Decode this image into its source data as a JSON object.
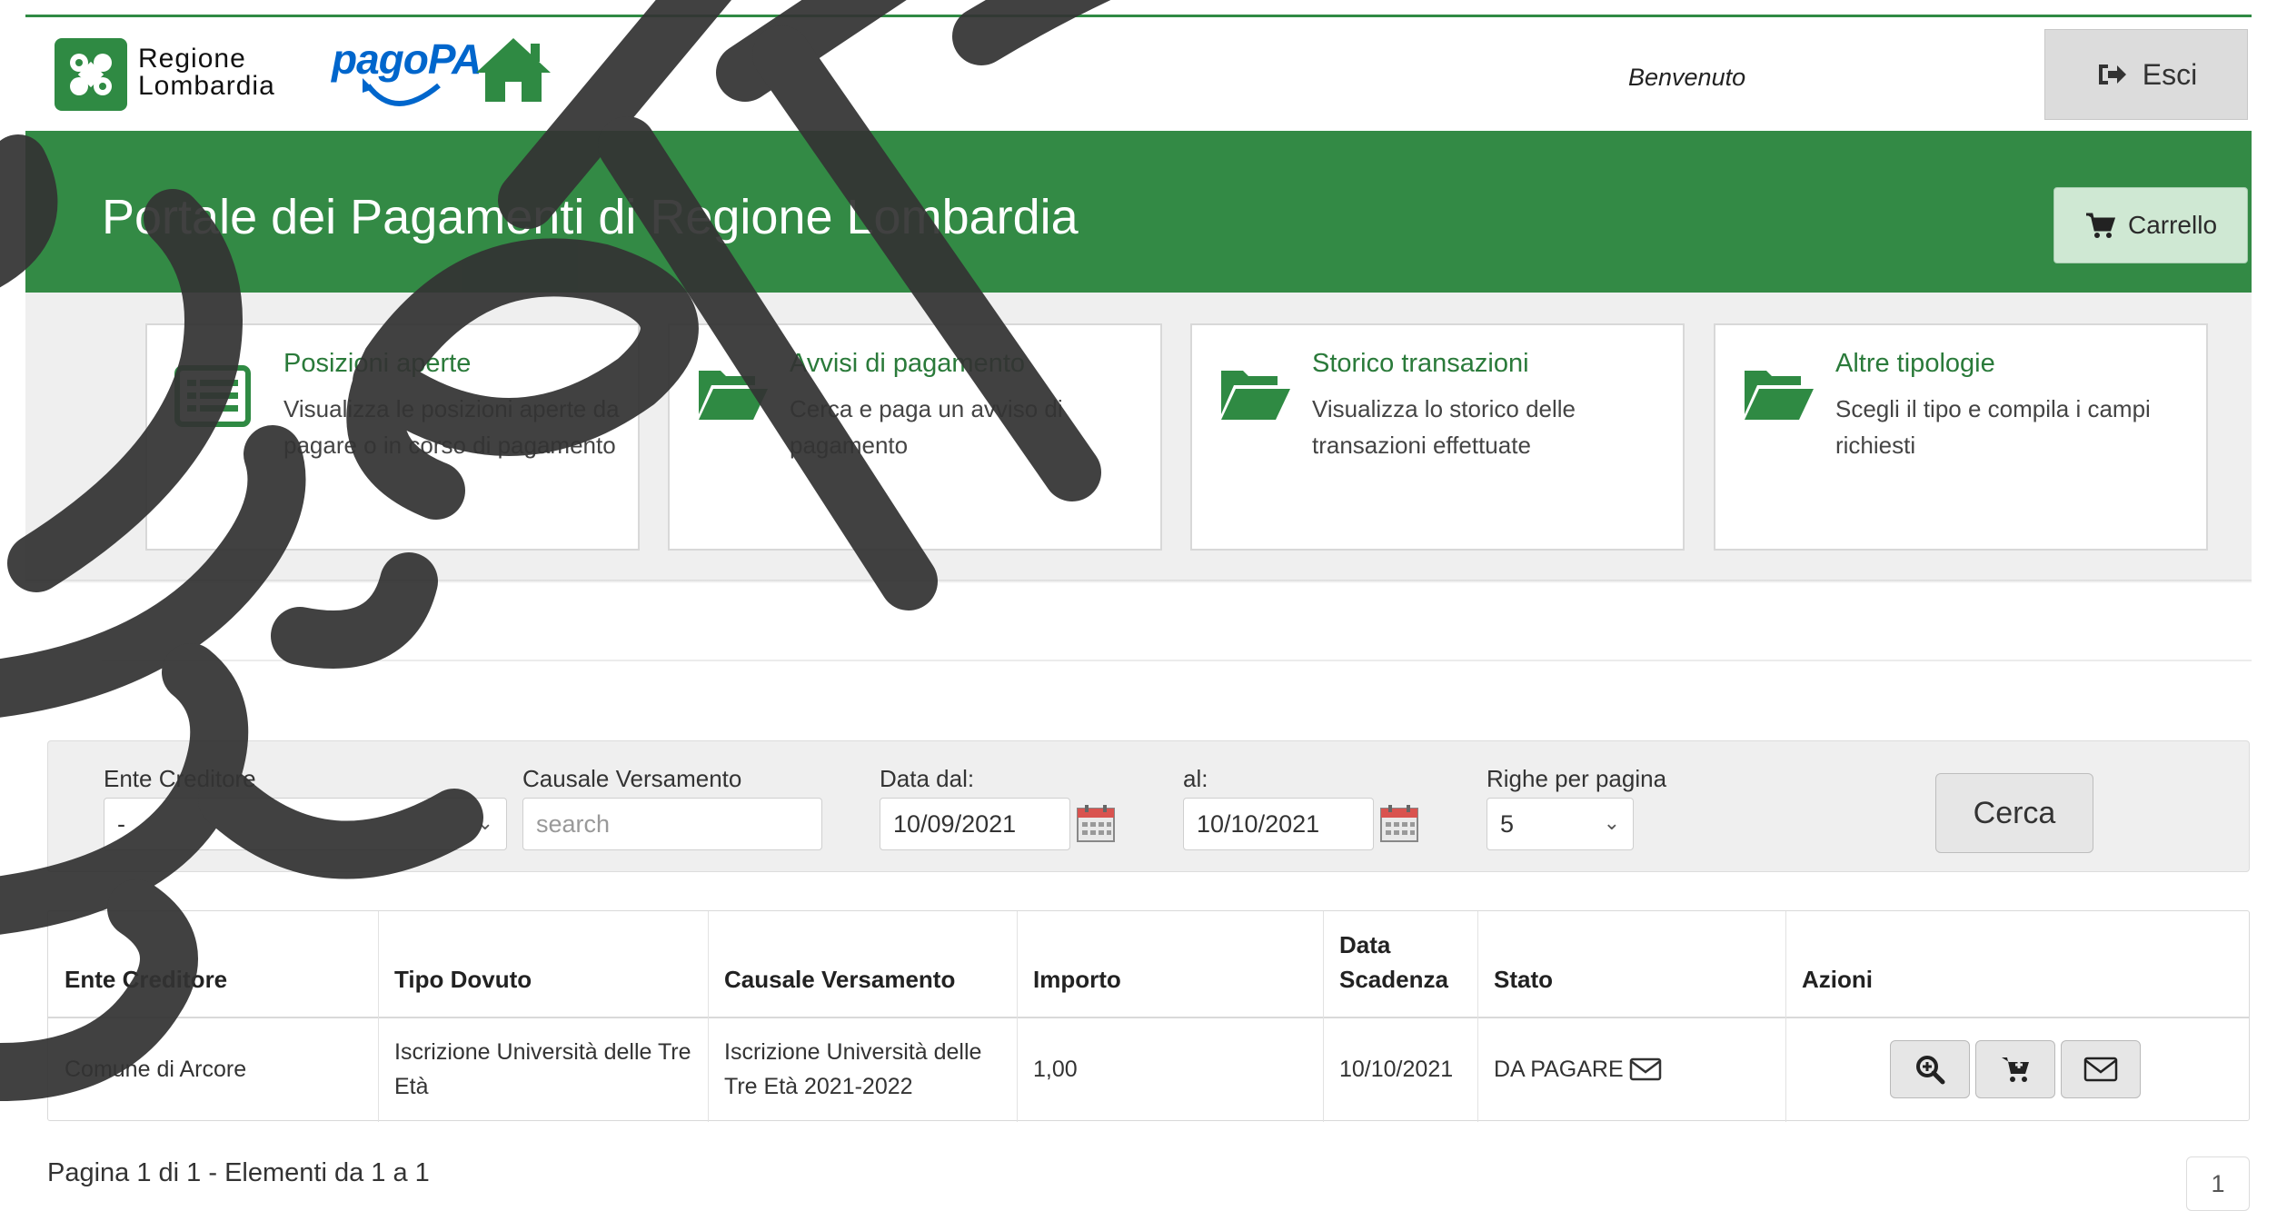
{
  "header": {
    "logo_line1": "Regione",
    "logo_line2": "Lombardia",
    "pagopa_logo": "pagoPA",
    "home_icon": "home-icon",
    "welcome": "Benvenuto",
    "logout_label": "Esci"
  },
  "banner": {
    "title": "Portale dei Pagamenti di Regione Lombardia",
    "cart_label": "Carrello"
  },
  "cards": [
    {
      "title": "Posizioni aperte",
      "desc": "Visualizza le posizioni aperte da pagare o in corso di pagamento",
      "icon": "list-icon"
    },
    {
      "title": "Avvisi di pagamento",
      "desc": "Cerca e paga un avviso di pagamento",
      "icon": "folder-open-icon"
    },
    {
      "title": "Storico transazioni",
      "desc": "Visualizza lo storico delle transazioni effettuate",
      "icon": "folder-open-icon"
    },
    {
      "title": "Altre tipologie",
      "desc": "Scegli il tipo e compila i campi richiesti",
      "icon": "folder-open-icon"
    }
  ],
  "filters": {
    "ente_label": "Ente Creditore",
    "ente_value": "-",
    "causale_label": "Causale Versamento",
    "causale_placeholder": "search",
    "data_dal_label": "Data dal:",
    "data_dal_value": "10/09/2021",
    "data_al_label": "al:",
    "data_al_value": "10/10/2021",
    "righe_label": "Righe per pagina",
    "righe_value": "5",
    "search_button": "Cerca"
  },
  "table": {
    "headers": [
      "Ente Creditore",
      "Tipo Dovuto",
      "Causale Versamento",
      "Importo",
      "Data Scadenza",
      "Stato",
      "Azioni"
    ],
    "rows": [
      {
        "ente": "Comune di Arcore",
        "tipo": "Iscrizione Università delle Tre Età",
        "causale": "Iscrizione Università delle Tre Età 2021-2022",
        "importo": "1,00",
        "scadenza": "10/10/2021",
        "stato": "DA PAGARE"
      }
    ]
  },
  "pagination": {
    "info": "Pagina 1 di 1 - Elementi da 1 a 1",
    "current_page": "1"
  },
  "colors": {
    "brand_green": "#338a45",
    "link_green": "#2a7a3a",
    "cart_bg": "#cfe8d3"
  }
}
